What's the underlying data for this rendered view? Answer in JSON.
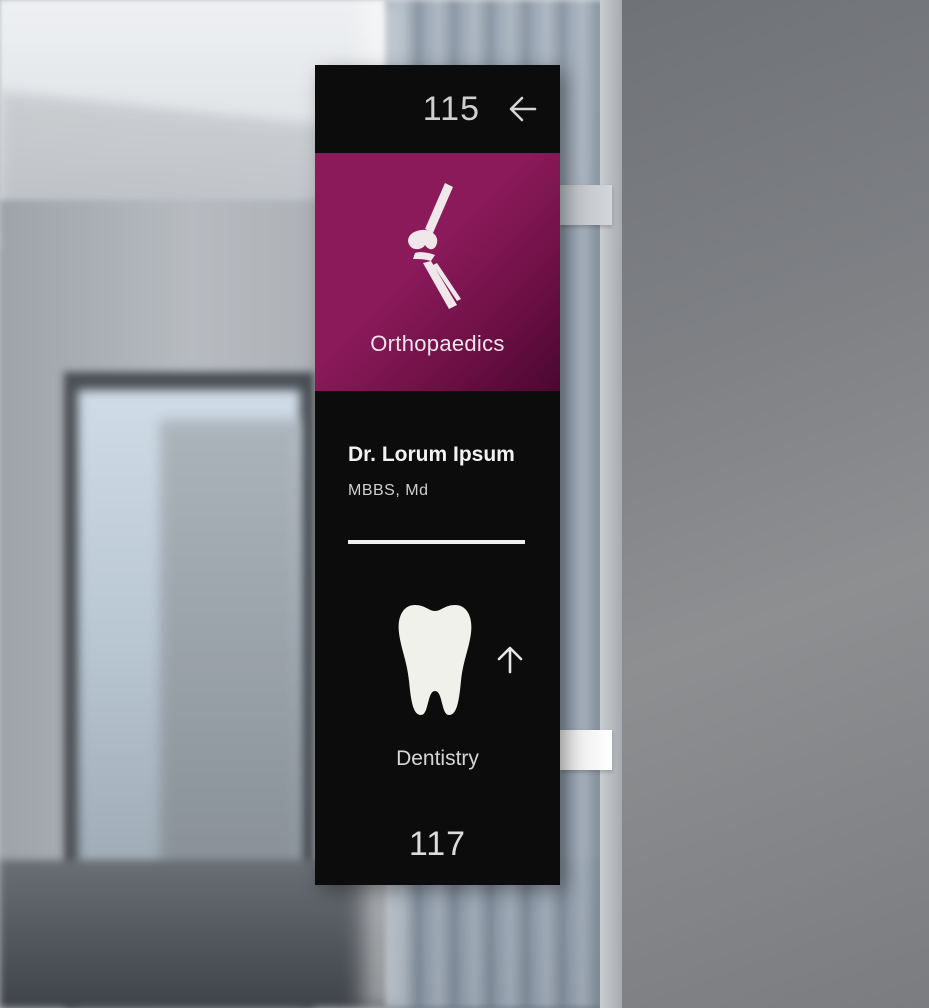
{
  "sign": {
    "top_room_number": "115",
    "top_direction_icon": "arrow-left-icon",
    "department_1": {
      "name": "Orthopaedics",
      "icon": "knee-joint-icon",
      "color": "#8b1a5b"
    },
    "doctor": {
      "name": "Dr. Lorum Ipsum",
      "credentials": "MBBS, Md"
    },
    "department_2": {
      "name": "Dentistry",
      "icon": "tooth-icon",
      "direction_icon": "arrow-up-icon"
    },
    "bottom_room_number": "117"
  }
}
